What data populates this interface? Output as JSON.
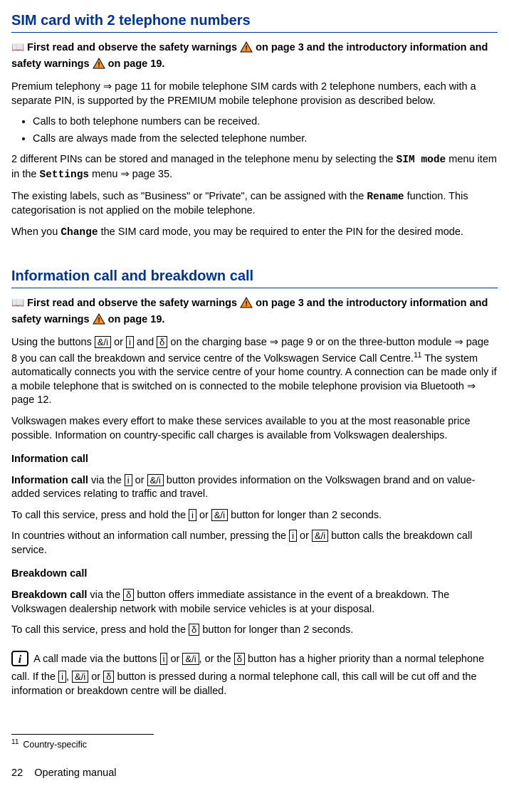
{
  "section1": {
    "title": "SIM card with 2 telephone numbers",
    "warn_pre": "First read and observe the safety warnings",
    "warn_mid": "on page 3 and the introductory information and safety warnings",
    "warn_post": "on page 19.",
    "p1_a": "Premium telephony ⇒ page 11 for mobile telephone SIM cards with 2 telephone numbers, each with a separate PIN, is supported by the PREMIUM mobile telephone provision as described below.",
    "li1": "Calls to both telephone numbers can be received.",
    "li2": "Calls are always made from the selected telephone number.",
    "p2_a": "2 different PINs can be stored and managed in the telephone menu by selecting the ",
    "p2_sim": "SIM mode",
    "p2_b": " menu item in the ",
    "p2_settings": "Settings",
    "p2_c": " menu ⇒ page 35.",
    "p3_a": "The existing labels, such as \"Business\" or \"Private\", can be assigned with the ",
    "p3_rename": "Rename",
    "p3_b": " function. This categorisation is not applied on the mobile telephone.",
    "p4_a": "When you ",
    "p4_change": "Change",
    "p4_b": " the SIM card mode, you may be required to enter the PIN for the desired mode."
  },
  "section2": {
    "title": "Information call and breakdown call",
    "warn_pre": "First read and observe the safety warnings",
    "warn_mid": "on page 3 and the introductory information and safety warnings",
    "warn_post": "on page 19.",
    "p1_a": "Using the buttons ",
    "btn_amp_i": "&/i",
    "p1_b": " or ",
    "btn_i": "i",
    "p1_c": " and ",
    "btn_wrench": "δ",
    "p1_d": " on the charging base ⇒ page 9 or on the three-button module ⇒ page 8 you can call the breakdown and service centre of the Volkswagen Service Call Centre.",
    "fn_ref": "11",
    "p1_e": " The system automatically connects you with the service centre of your home country. A connection can be made only if a mobile telephone that is switched on is connected to the mobile telephone provision via Bluetooth ⇒ page 12.",
    "p2": "Volkswagen makes every effort to make these services available to you at the most reasonable price possible. Information on country-specific call charges is available from Volkswagen dealerships.",
    "sub1": "Information call",
    "p3_a": "Information call",
    "p3_b": " via the ",
    "p3_c": " or ",
    "p3_d": " button provides information on the Volkswagen brand and on value-added services relating to traffic and travel.",
    "p4_a": "To call this service, press and hold the ",
    "p4_b": " or ",
    "p4_c": " button for longer than 2 seconds.",
    "p5_a": "In countries without an information call number, pressing the ",
    "p5_b": " or ",
    "p5_c": " button calls the breakdown call service.",
    "sub2": "Breakdown call",
    "p6_a": "Breakdown call",
    "p6_b": " via the ",
    "p6_c": " button offers immediate assistance in the event of a breakdown. The Volkswagen dealership network with mobile service vehicles is at your disposal.",
    "p7_a": "To call this service, press and hold the ",
    "p7_b": " button for longer than 2 seconds.",
    "note_a": "A call made via the buttons ",
    "note_b": " or ",
    "note_c": ", or the ",
    "note_d": " button has a higher priority than a normal telephone call. If the ",
    "note_e": ", ",
    "note_f": " or ",
    "note_g": " button is pressed during a normal telephone call, this call will be cut off and the information or breakdown centre will be dialled."
  },
  "footnote": {
    "num": "11",
    "text": "Country-specific"
  },
  "footer": {
    "page": "22",
    "label": "Operating manual"
  }
}
